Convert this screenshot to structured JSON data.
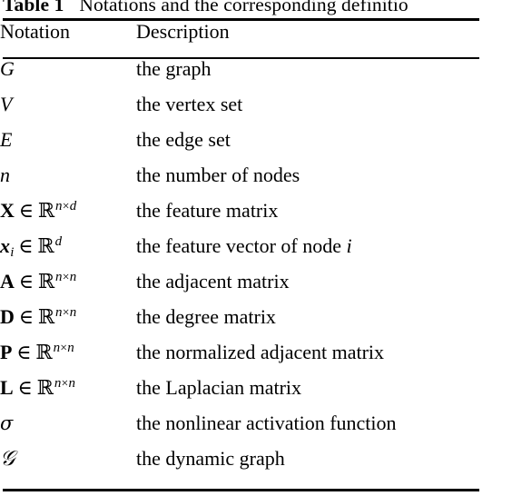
{
  "caption": {
    "label": "Table 1",
    "text": "Notations and the corresponding definitio",
    "full_text_visible": "Table 1   Notations and the corresponding definitio"
  },
  "table": {
    "columns": [
      {
        "header": "Notation"
      },
      {
        "header": "Description"
      }
    ],
    "rows": [
      {
        "notation": "G",
        "description": "the graph"
      },
      {
        "notation": "V",
        "description": "the vertex set"
      },
      {
        "notation": "E",
        "description": "the edge set"
      },
      {
        "notation": "n",
        "description": "the number of nodes"
      },
      {
        "notation": "X ∈ ℝ^{n×d}",
        "description": "the feature matrix"
      },
      {
        "notation": "x_i ∈ ℝ^{d}",
        "description": "the feature vector of node i"
      },
      {
        "notation": "A ∈ ℝ^{n×n}",
        "description": "the adjacent matrix"
      },
      {
        "notation": "D ∈ ℝ^{n×n}",
        "description": "the degree matrix"
      },
      {
        "notation": "P ∈ ℝ^{n×n}",
        "description": "the normalized adjacent matrix"
      },
      {
        "notation": "L ∈ ℝ^{n×n}",
        "description": "the Laplacian matrix"
      },
      {
        "notation": "σ",
        "description": "the nonlinear activation function"
      },
      {
        "notation": "𝒢",
        "description": "the dynamic graph"
      }
    ],
    "symbols": {
      "in": "∈",
      "times": "×",
      "blackboard_r": "ℝ",
      "sigma": "σ",
      "script_g": "𝒢",
      "n": "n",
      "d": "d",
      "i": "i"
    },
    "descriptions": {
      "graph": "the graph",
      "vertex_set": "the vertex set",
      "edge_set": "the edge set",
      "num_nodes": "the number of nodes",
      "feature_matrix": "the feature matrix",
      "feature_vector_prefix": "the feature vector of node ",
      "adjacent_matrix": "the adjacent matrix",
      "degree_matrix": "the degree matrix",
      "normalized_adjacent_matrix": "the normalized adjacent matrix",
      "laplacian_matrix": "the Laplacian matrix",
      "activation_function": "the nonlinear activation function",
      "dynamic_graph": "the dynamic graph"
    }
  },
  "style": {
    "rule_color": "#000000",
    "text_color": "#000000",
    "background": "#ffffff"
  }
}
